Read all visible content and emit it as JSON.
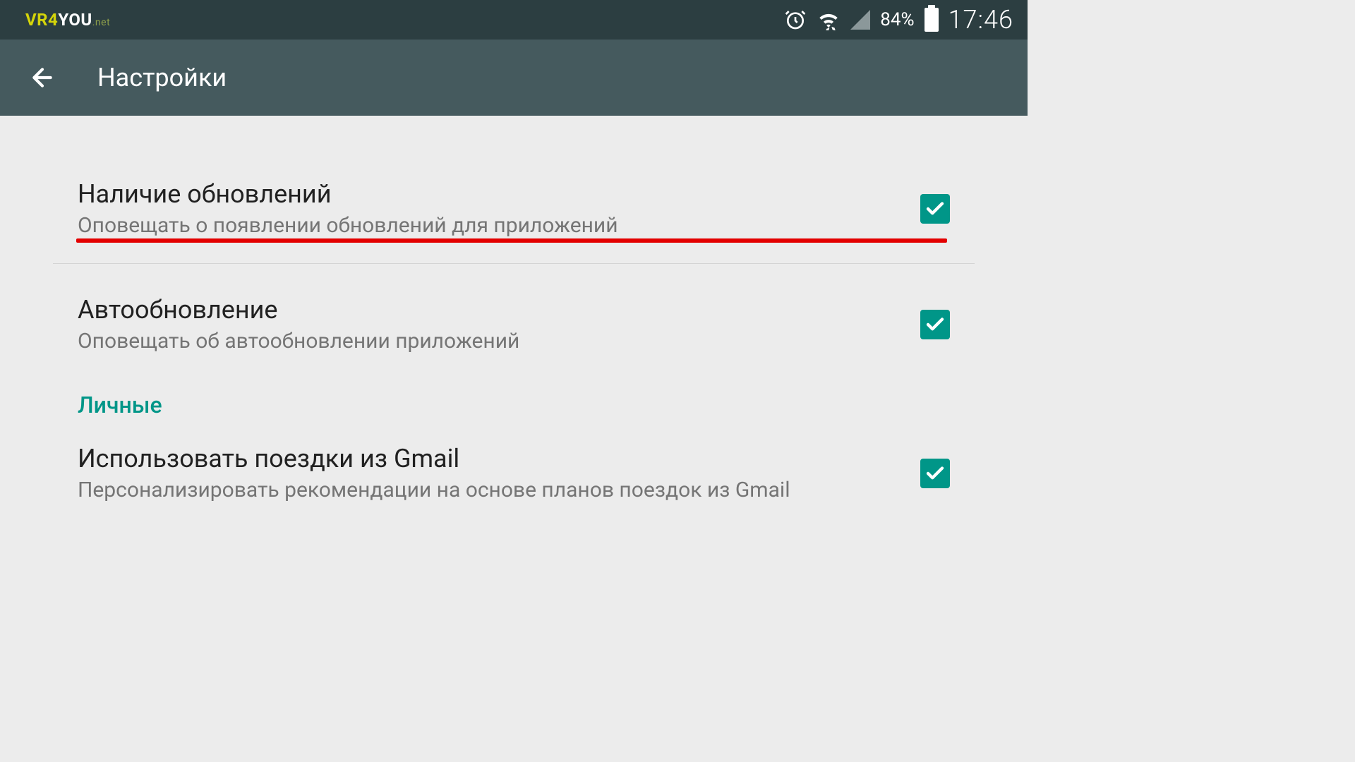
{
  "status": {
    "logo_vr4": "VR4",
    "logo_you": "YOU",
    "logo_net": ".net",
    "battery_percent": "84%",
    "time": "17:46"
  },
  "appbar": {
    "title": "Настройки"
  },
  "settings": {
    "item1": {
      "title": "Наличие обновлений",
      "subtitle": "Оповещать о появлении обновлений для приложений"
    },
    "item2": {
      "title": "Автообновление",
      "subtitle": "Оповещать об автообновлении приложений"
    },
    "section_header": "Личные",
    "item3": {
      "title": "Использовать поездки из Gmail",
      "subtitle": "Персонализировать рекомендации на основе планов поездок из Gmail"
    }
  }
}
